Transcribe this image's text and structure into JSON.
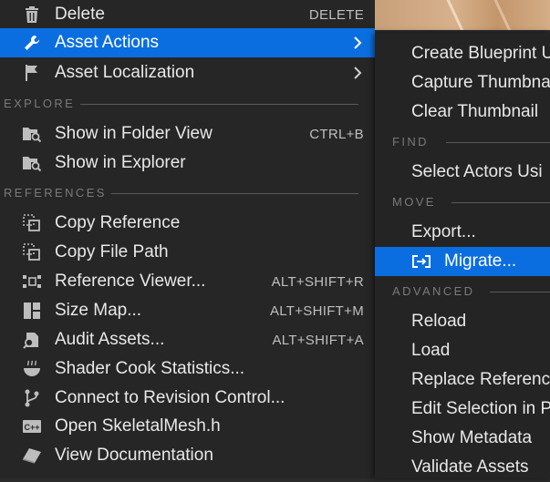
{
  "main_menu": {
    "delete": {
      "label": "Delete",
      "shortcut": "DELETE"
    },
    "asset_actions": {
      "label": "Asset Actions"
    },
    "asset_localization": {
      "label": "Asset Localization"
    },
    "explore_header": "EXPLORE",
    "show_in_folder_view": {
      "label": "Show in Folder View",
      "shortcut": "CTRL+B"
    },
    "show_in_explorer": {
      "label": "Show in Explorer"
    },
    "references_header": "REFERENCES",
    "copy_reference": {
      "label": "Copy Reference"
    },
    "copy_file_path": {
      "label": "Copy File Path"
    },
    "reference_viewer": {
      "label": "Reference Viewer...",
      "shortcut": "ALT+SHIFT+R"
    },
    "size_map": {
      "label": "Size Map...",
      "shortcut": "ALT+SHIFT+M"
    },
    "audit_assets": {
      "label": "Audit Assets...",
      "shortcut": "ALT+SHIFT+A"
    },
    "shader_cook_statistics": {
      "label": "Shader Cook Statistics..."
    },
    "connect_revision_control": {
      "label": "Connect to Revision Control..."
    },
    "open_skeletal_mesh": {
      "label": "Open SkeletalMesh.h"
    },
    "view_documentation": {
      "label": "View Documentation"
    }
  },
  "sub_menu": {
    "create_blueprint": "Create Blueprint U",
    "capture_thumbnail": "Capture Thumbna",
    "clear_thumbnail": "Clear Thumbnail",
    "find_header": "FIND",
    "select_actors": "Select Actors Usi",
    "move_header": "MOVE",
    "export": "Export...",
    "migrate": "Migrate...",
    "advanced_header": "ADVANCED",
    "reload": "Reload",
    "load": "Load",
    "replace_references": "Replace Referenc",
    "edit_selection": "Edit Selection in P",
    "show_metadata": "Show Metadata",
    "validate_assets": "Validate Assets"
  },
  "colors": {
    "menu_bg": "#262626",
    "highlight": "#0b6ee0",
    "section_text": "#7a7a7a",
    "text": "#e8e8e8"
  }
}
